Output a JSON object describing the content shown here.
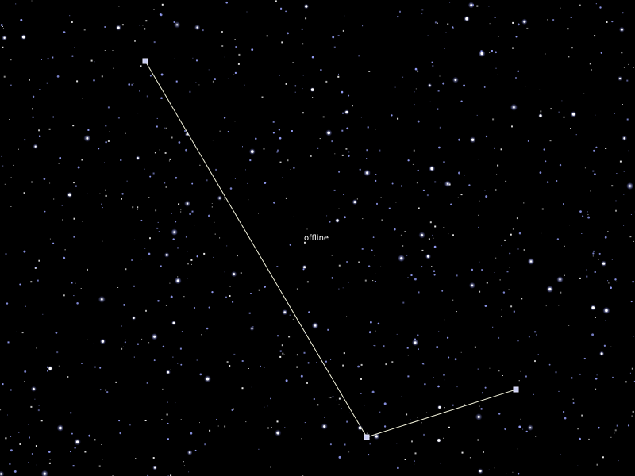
{
  "status": {
    "text": "offline"
  },
  "colors": {
    "background": "#000000",
    "star_core": "#ffffff",
    "star_glow": "#9aa4ff",
    "link_line": "#f4f4dc",
    "node_fill": "#c9cdf2",
    "node_stroke": "#e8e8ff",
    "status_text": "#ffffff"
  },
  "path": {
    "node_count": 3,
    "segment_count": 2,
    "node_icon": "square-node-icon"
  }
}
